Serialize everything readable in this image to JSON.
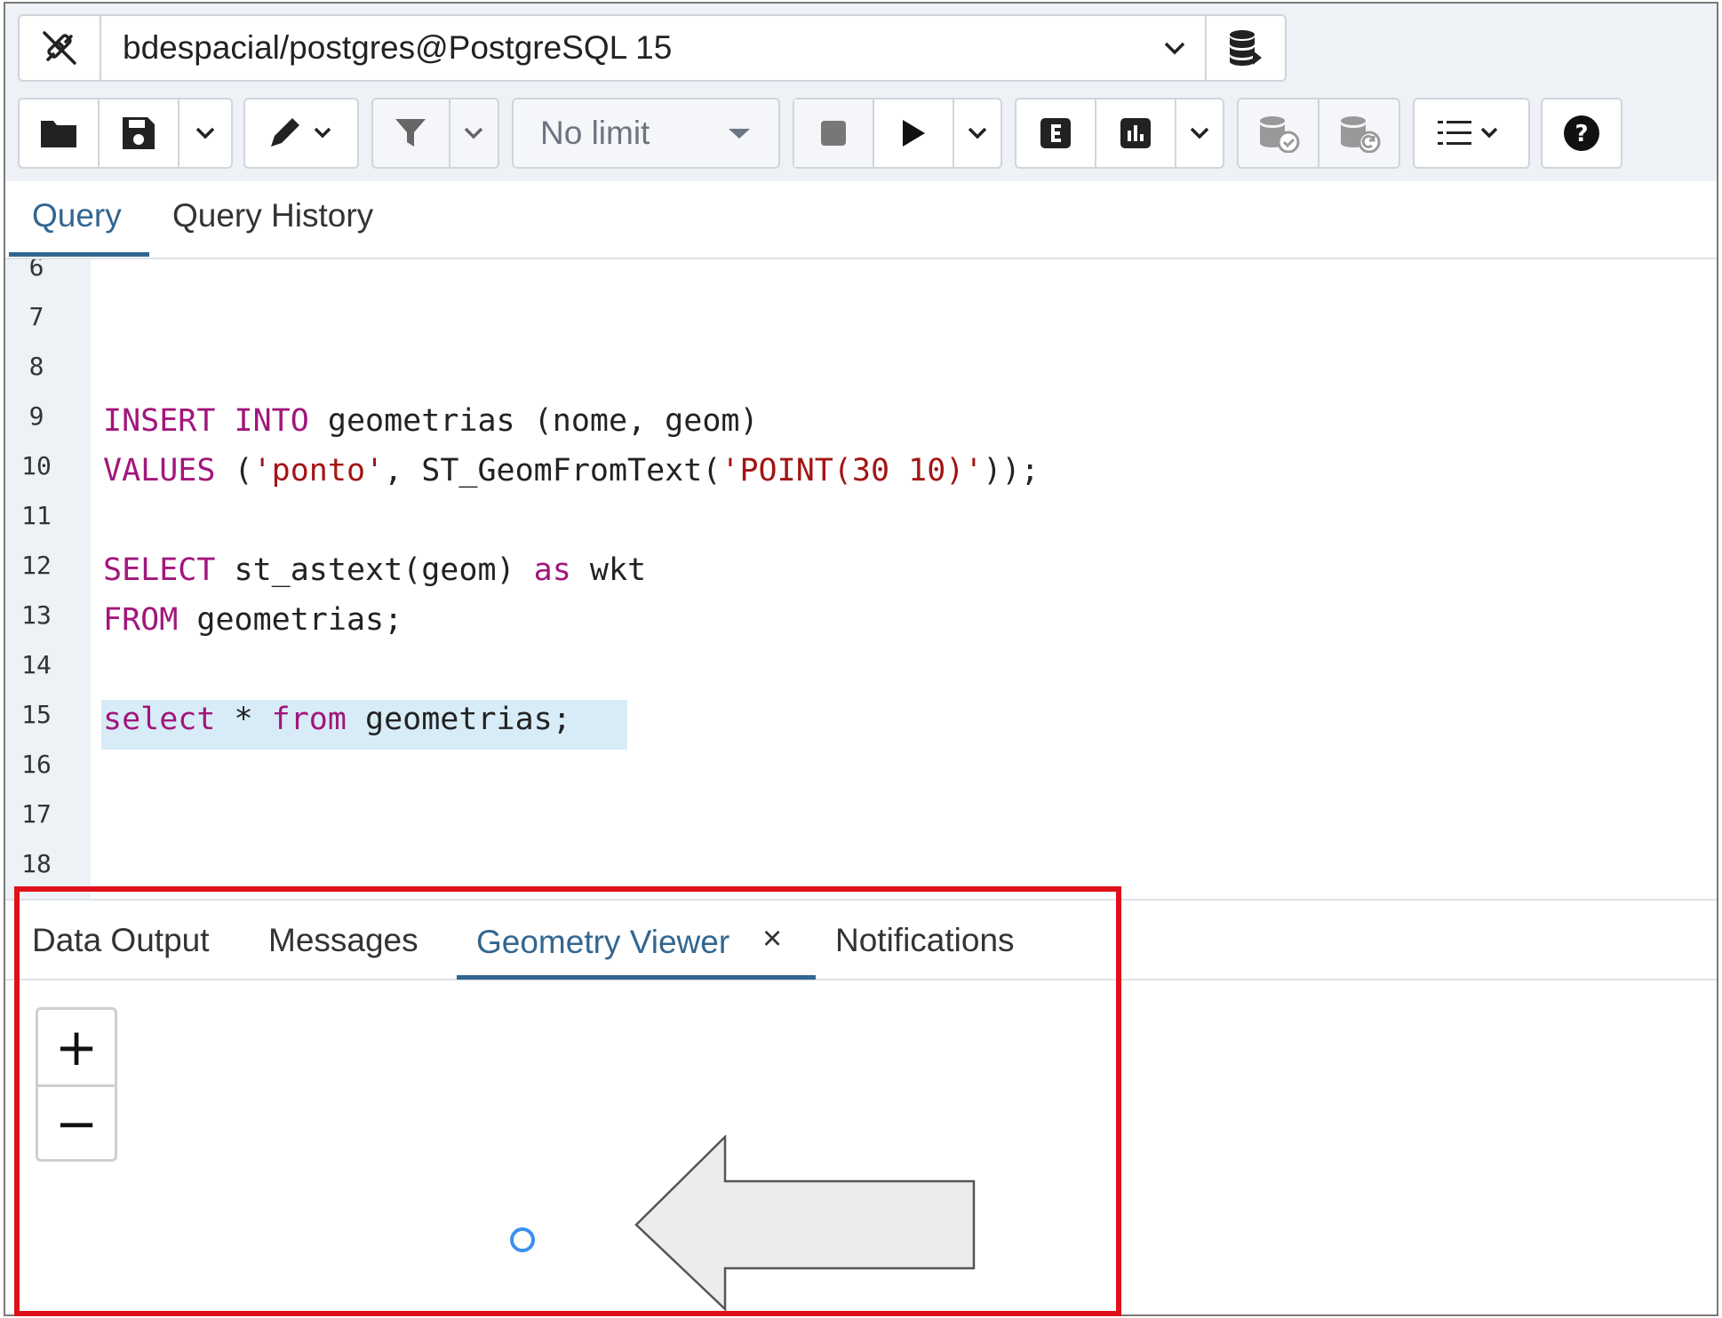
{
  "connection": {
    "title": "bdespacial/postgres@PostgreSQL 15",
    "icon": "plug-disconnected-icon",
    "db_icon": "database-icon"
  },
  "toolbar": {
    "limit_label": "No limit",
    "icons": [
      "folder-icon",
      "save-icon",
      "chevron-down-icon",
      "edit-pen-icon",
      "filter-icon",
      "stop-icon",
      "play-icon",
      "explain-icon",
      "chart-icon",
      "commit-icon",
      "rollback-icon",
      "list-icon",
      "help-icon"
    ]
  },
  "query_tabs": [
    {
      "label": "Query",
      "active": true
    },
    {
      "label": "Query History",
      "active": false
    }
  ],
  "editor": {
    "lines": [
      {
        "n": "6"
      },
      {
        "n": "7"
      },
      {
        "n": "8"
      },
      {
        "n": "9"
      },
      {
        "n": "10"
      },
      {
        "n": "11"
      },
      {
        "n": "12"
      },
      {
        "n": "13"
      },
      {
        "n": "14"
      },
      {
        "n": "15"
      },
      {
        "n": "16"
      },
      {
        "n": "17"
      },
      {
        "n": "18"
      }
    ],
    "code": {
      "l9_kw1": "INSERT",
      "l9_kw2": "INTO",
      "l9_rest": " geometrias (nome, geom)",
      "l10_kw": "VALUES",
      "l10_p1": " (",
      "l10_s1": "'ponto'",
      "l10_p2": ", ST_GeomFromText(",
      "l10_s2": "'POINT(30 10)'",
      "l10_p3": "));",
      "l12_kw1": "SELECT",
      "l12_mid": " st_astext(geom) ",
      "l12_kw2": "as",
      "l12_rest": " wkt",
      "l13_kw": "FROM",
      "l13_rest": " geometrias;",
      "l15_kw1": "select",
      "l15_mid": " * ",
      "l15_kw2": "from",
      "l15_rest": " geometrias;"
    }
  },
  "result_tabs": [
    {
      "label": "Data Output"
    },
    {
      "label": "Messages"
    },
    {
      "label": "Geometry Viewer",
      "active": true,
      "close": "×"
    },
    {
      "label": "Notifications"
    }
  ],
  "map": {
    "zoom_in": "+",
    "zoom_out": "−"
  },
  "colors": {
    "accent": "#326690",
    "keyword": "#a2167b",
    "string": "#a31515",
    "highlight_box": "#e0101a",
    "point": "#3b8ff0"
  }
}
